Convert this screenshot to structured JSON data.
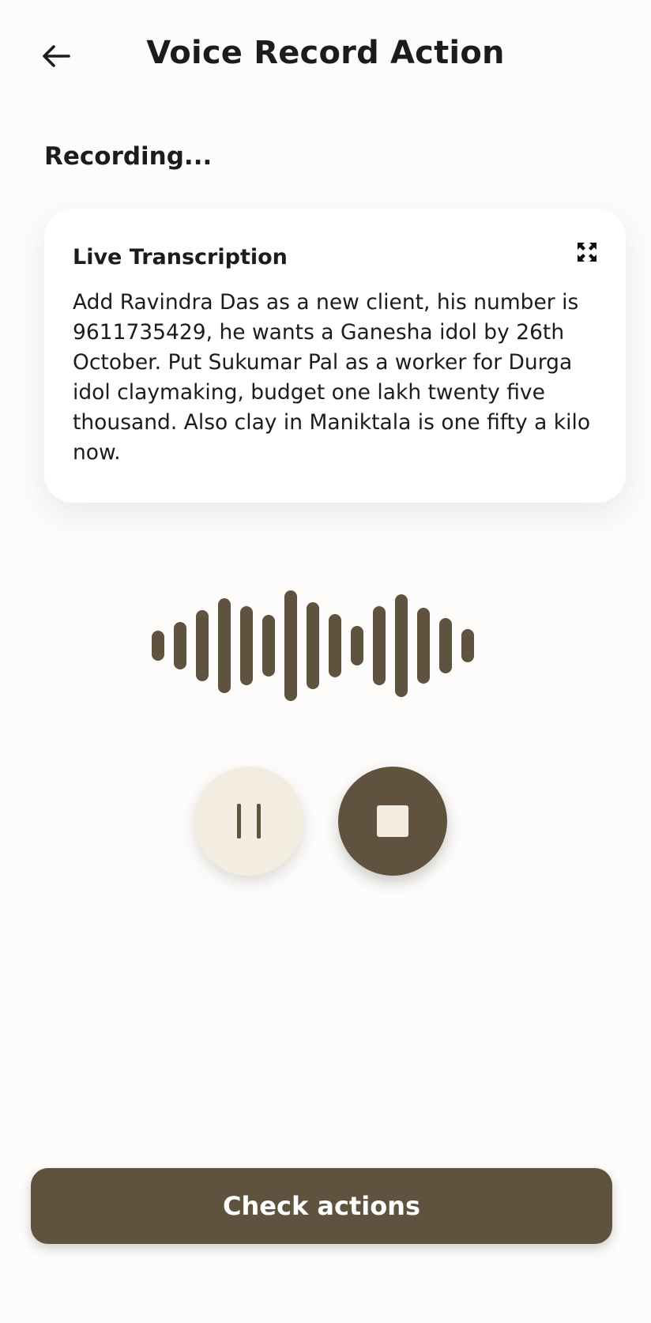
{
  "header": {
    "title": "Voice Record Action",
    "back_icon": "arrow-left-icon"
  },
  "status": {
    "label": "Recording..."
  },
  "transcription": {
    "title": "Live Transcription",
    "expand_icon": "expand-icon",
    "text": "Add Ravindra Das as a new client, his number is 9611735429, he wants a Ganesha idol by 26th October. Put Sukumar Pal as a worker for Durga idol claymaking, budget one lakh twenty five thousand. Also clay in Maniktala is one fifty a kilo now."
  },
  "controls": {
    "pause_icon": "pause-icon",
    "stop_icon": "stop-icon"
  },
  "footer": {
    "check_actions_label": "Check actions"
  },
  "colors": {
    "primary": "#5f5340",
    "secondary": "#f3ece1",
    "background": "#fdfcfb",
    "text": "#1c1b1f"
  }
}
